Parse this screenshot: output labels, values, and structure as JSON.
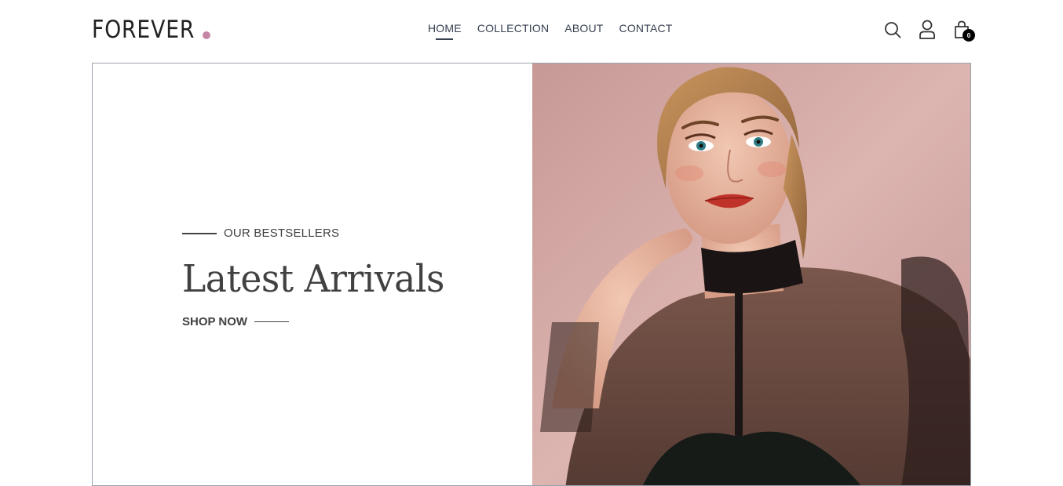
{
  "brand": {
    "name": "FOREVER",
    "accent_color": "#c586a5"
  },
  "nav": {
    "items": [
      {
        "label": "HOME",
        "active": true
      },
      {
        "label": "COLLECTION",
        "active": false
      },
      {
        "label": "ABOUT",
        "active": false
      },
      {
        "label": "CONTACT",
        "active": false
      }
    ]
  },
  "header_icons": {
    "search": "search-icon",
    "profile": "profile-icon",
    "cart": "cart-icon",
    "cart_count": "0"
  },
  "hero": {
    "tagline": "OUR BESTSELLERS",
    "title": "Latest Arrivals",
    "cta": "SHOP NOW",
    "image": "hero-model-image"
  }
}
